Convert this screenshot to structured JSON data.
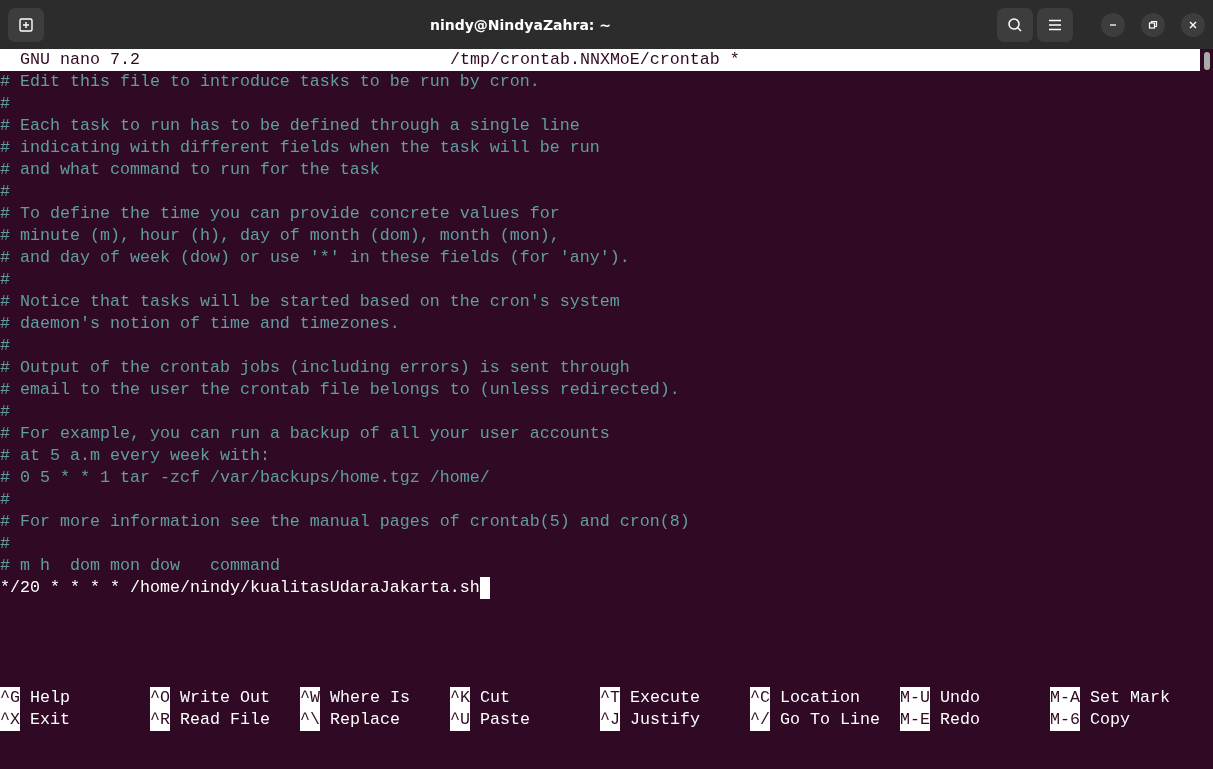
{
  "window": {
    "title": "nindy@NindyaZahra: ~"
  },
  "nano_header": {
    "version": "GNU nano 7.2",
    "filename": "/tmp/crontab.NNXMoE/crontab *"
  },
  "lines": [
    {
      "kind": "comment",
      "text": "# Edit this file to introduce tasks to be run by cron.",
      "cursor": false
    },
    {
      "kind": "comment",
      "text": "#",
      "cursor": false
    },
    {
      "kind": "comment",
      "text": "# Each task to run has to be defined through a single line",
      "cursor": false
    },
    {
      "kind": "comment",
      "text": "# indicating with different fields when the task will be run",
      "cursor": false
    },
    {
      "kind": "comment",
      "text": "# and what command to run for the task",
      "cursor": false
    },
    {
      "kind": "comment",
      "text": "#",
      "cursor": false
    },
    {
      "kind": "comment",
      "text": "# To define the time you can provide concrete values for",
      "cursor": false
    },
    {
      "kind": "comment",
      "text": "# minute (m), hour (h), day of month (dom), month (mon),",
      "cursor": false
    },
    {
      "kind": "comment",
      "text": "# and day of week (dow) or use '*' in these fields (for 'any').",
      "cursor": false
    },
    {
      "kind": "comment",
      "text": "#",
      "cursor": false
    },
    {
      "kind": "comment",
      "text": "# Notice that tasks will be started based on the cron's system",
      "cursor": false
    },
    {
      "kind": "comment",
      "text": "# daemon's notion of time and timezones.",
      "cursor": false
    },
    {
      "kind": "comment",
      "text": "#",
      "cursor": false
    },
    {
      "kind": "comment",
      "text": "# Output of the crontab jobs (including errors) is sent through",
      "cursor": false
    },
    {
      "kind": "comment",
      "text": "# email to the user the crontab file belongs to (unless redirected).",
      "cursor": false
    },
    {
      "kind": "comment",
      "text": "#",
      "cursor": false
    },
    {
      "kind": "comment",
      "text": "# For example, you can run a backup of all your user accounts",
      "cursor": false
    },
    {
      "kind": "comment",
      "text": "# at 5 a.m every week with:",
      "cursor": false
    },
    {
      "kind": "comment",
      "text": "# 0 5 * * 1 tar -zcf /var/backups/home.tgz /home/",
      "cursor": false
    },
    {
      "kind": "comment",
      "text": "#",
      "cursor": false
    },
    {
      "kind": "comment",
      "text": "# For more information see the manual pages of crontab(5) and cron(8)",
      "cursor": false
    },
    {
      "kind": "comment",
      "text": "#",
      "cursor": false
    },
    {
      "kind": "comment",
      "text": "# m h  dom mon dow   command",
      "cursor": false
    },
    {
      "kind": "code",
      "text": "*/20 * * * * /home/nindy/kualitasUdaraJakarta.sh",
      "cursor": true
    }
  ],
  "shortcuts": [
    [
      {
        "key": "^G",
        "label": "Help"
      },
      {
        "key": "^O",
        "label": "Write Out"
      },
      {
        "key": "^W",
        "label": "Where Is"
      },
      {
        "key": "^K",
        "label": "Cut"
      },
      {
        "key": "^T",
        "label": "Execute"
      },
      {
        "key": "^C",
        "label": "Location"
      },
      {
        "key": "M-U",
        "label": "Undo"
      },
      {
        "key": "M-A",
        "label": "Set Mark"
      }
    ],
    [
      {
        "key": "^X",
        "label": "Exit"
      },
      {
        "key": "^R",
        "label": "Read File"
      },
      {
        "key": "^\\",
        "label": "Replace"
      },
      {
        "key": "^U",
        "label": "Paste"
      },
      {
        "key": "^J",
        "label": "Justify"
      },
      {
        "key": "^/",
        "label": "Go To Line"
      },
      {
        "key": "M-E",
        "label": "Redo"
      },
      {
        "key": "M-6",
        "label": "Copy"
      }
    ]
  ]
}
